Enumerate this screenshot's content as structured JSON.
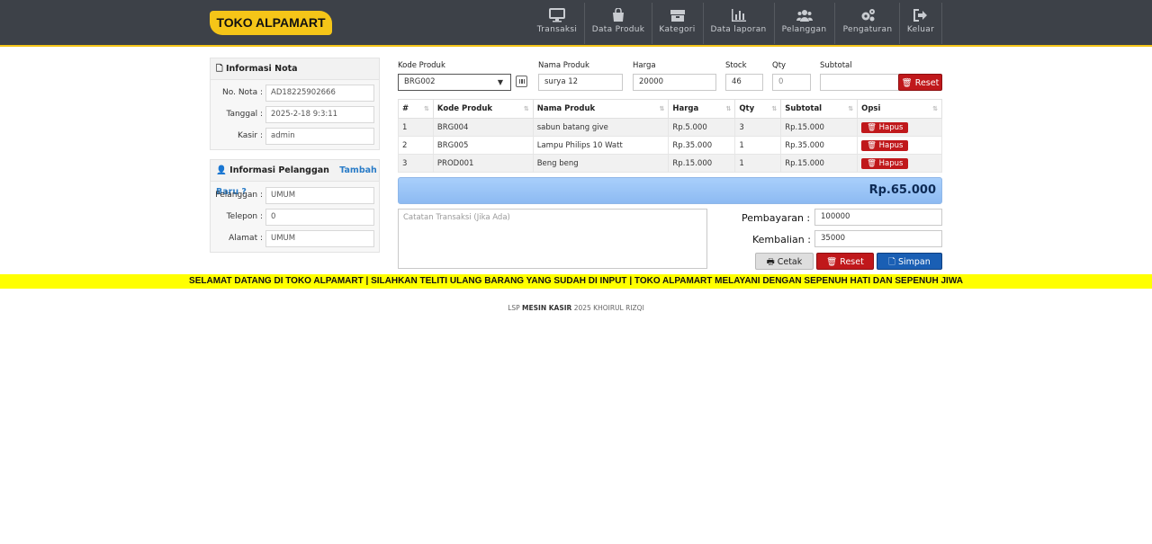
{
  "brand": {
    "title": "TOKO ALPAMART",
    "accent": "#f5c518",
    "topbar_bg": "#3d4148"
  },
  "nav": {
    "items": [
      {
        "label": "Transaksi",
        "icon": "monitor-icon"
      },
      {
        "label": "Data Produk",
        "icon": "shopping-bag-icon"
      },
      {
        "label": "Kategori",
        "icon": "boxes-icon"
      },
      {
        "label": "Data laporan",
        "icon": "bar-chart-icon"
      },
      {
        "label": "Pelanggan",
        "icon": "users-icon"
      },
      {
        "label": "Pengaturan",
        "icon": "gears-icon"
      },
      {
        "label": "Keluar",
        "icon": "sign-out-icon"
      }
    ]
  },
  "nota": {
    "title": "Informasi Nota",
    "no_label": "No. Nota :",
    "no_value": "AD18225902666",
    "tanggal_label": "Tanggal :",
    "tanggal_value": "2025-2-18 9:3:11",
    "kasir_label": "Kasir :",
    "kasir_value": "admin"
  },
  "pelanggan": {
    "title": "Informasi Pelanggan",
    "add_link": "Tambah Baru ?",
    "pelanggan_label": "Pelanggan :",
    "pelanggan_value": "UMUM",
    "telepon_label": "Telepon :",
    "telepon_value": "0",
    "alamat_label": "Alamat :",
    "alamat_value": "UMUM"
  },
  "entry": {
    "kode_label": "Kode Produk",
    "kode_value": "BRG002",
    "nama_label": "Nama Produk",
    "nama_value": "surya 12",
    "harga_label": "Harga",
    "harga_value": "20000",
    "stock_label": "Stock",
    "stock_value": "46",
    "qty_label": "Qty",
    "qty_value": "0",
    "subtotal_label": "Subtotal",
    "subtotal_value": "",
    "reset_label": "Reset"
  },
  "table": {
    "headers": [
      "#",
      "Kode Produk",
      "Nama Produk",
      "Harga",
      "Qty",
      "Subtotal",
      "Opsi"
    ],
    "rows": [
      {
        "no": "1",
        "kode": "BRG004",
        "nama": "sabun batang give",
        "harga": "Rp.5.000",
        "qty": "3",
        "subtotal": "Rp.15.000",
        "opsi": "Hapus"
      },
      {
        "no": "2",
        "kode": "BRG005",
        "nama": "Lampu Philips 10 Watt",
        "harga": "Rp.35.000",
        "qty": "1",
        "subtotal": "Rp.35.000",
        "opsi": "Hapus"
      },
      {
        "no": "3",
        "kode": "PROD001",
        "nama": "Beng beng",
        "harga": "Rp.15.000",
        "qty": "1",
        "subtotal": "Rp.15.000",
        "opsi": "Hapus"
      }
    ]
  },
  "total": {
    "amount": "Rp.65.000"
  },
  "notes": {
    "placeholder": "Catatan Transaksi (Jika Ada)"
  },
  "payment": {
    "bayar_label": "Pembayaran :",
    "bayar_value": "100000",
    "kembali_label": "Kembalian :",
    "kembali_value": "35000",
    "cetak_label": "Cetak",
    "reset_label": "Reset",
    "simpan_label": "Simpan"
  },
  "marquee": "SELAMAT DATANG DI TOKO ALPAMART | SILAHKAN TELITI ULANG BARANG YANG SUDAH DI INPUT | TOKO ALPAMART MELAYANI DENGAN SEPENUH HATI DAN SEPENUH JIWA",
  "footer": {
    "prefix": "LSP",
    "bold": "MESIN KASIR",
    "suffix": "2025 KHOIRUL RIZQI"
  }
}
